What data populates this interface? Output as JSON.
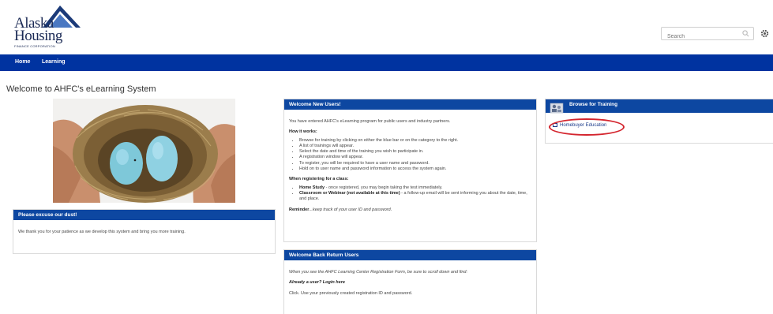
{
  "logo": {
    "line1": "Alaska",
    "line2": "Housing",
    "line3": "FINANCE CORPORATION"
  },
  "search": {
    "placeholder": "Search"
  },
  "nav": {
    "items": [
      "Home",
      "Learning"
    ]
  },
  "page_title": "Welcome to AHFC's eLearning System",
  "excuse_panel": {
    "title": "Please excuse our dust!",
    "body": "We thank you for your patience as we develop this system and bring you more training."
  },
  "new_users_panel": {
    "title": "Welcome New Users!",
    "intro": "You have entered AHFC's eLearning program for public users and industry partners.",
    "how_heading": "How it works:",
    "how_items": [
      "Browse for training by clicking on either the blue bar or on the category to the right.",
      "A list of trainings will appear.",
      "Select the date and time of the training you wish to participate in.",
      "A registration window will appear.",
      "To register, you will be required to have a user name and password.",
      "Hold on to user name and password information to access the system again."
    ],
    "when_heading": "When registering for a class:",
    "home_study_label": "Home Study",
    "home_study_text": " - once registered, you may begin taking the test immediately.",
    "classroom_label": "Classroom or Webinar (not available at this time)",
    "classroom_text": " - a follow-up email will be sent informing you about the date, time, and place.",
    "reminder_label": "Reminder",
    "reminder_text": "...keep track of your user ID and password."
  },
  "return_users_panel": {
    "title": "Welcome Back Return Users",
    "line1": "When you see the AHFC Learning Center Registration Form, be sure to scroll down and find:",
    "line2": "Already a user? Login here",
    "line3": "Click. Use your previously created registration ID and password."
  },
  "browse_panel": {
    "title": "Browse for Training",
    "items": [
      "Homebuyer Education"
    ]
  },
  "colors": {
    "nav": "#0033a0",
    "panel_header": "#0d47a1",
    "highlight": "#d4252e",
    "egg": "#7ec8d9"
  },
  "icons": [
    "logo-roof-icon",
    "search-icon",
    "gear-icon",
    "training-icon",
    "checkbox-icon"
  ]
}
